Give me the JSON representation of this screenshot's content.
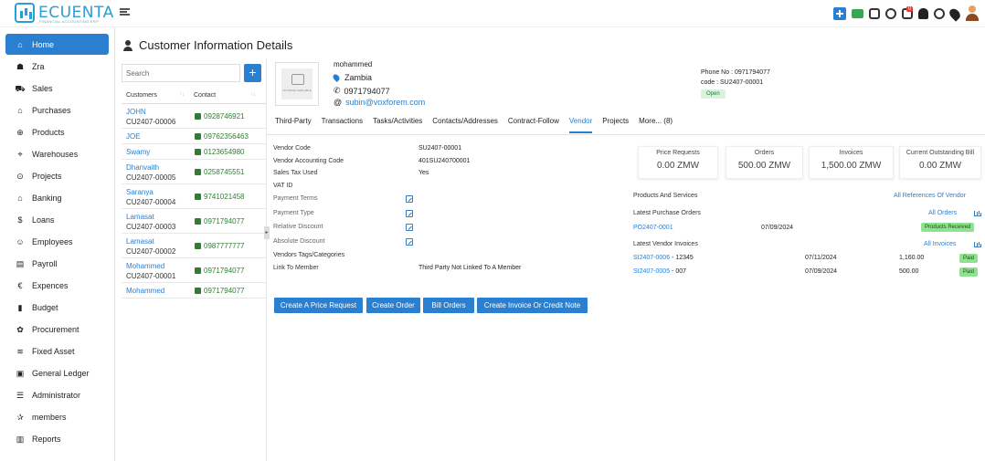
{
  "logo": {
    "text": "ECUENTA",
    "tagline": "FINANCIAL ACCOUNTING ERP"
  },
  "topbar": {
    "icons": [
      "plus-icon",
      "cash-icon",
      "printer-icon",
      "settings-icon",
      "building-icon",
      "bell-icon",
      "history-icon",
      "location-icon",
      "user-avatar-icon"
    ],
    "building_badge": "0"
  },
  "sidebar": {
    "items": [
      {
        "label": "Home",
        "icon": "⌂",
        "name": "home"
      },
      {
        "label": "Zra",
        "icon": "☗",
        "name": "zra"
      },
      {
        "label": "Sales",
        "icon": "⛟",
        "name": "sales"
      },
      {
        "label": "Purchases",
        "icon": "⌂",
        "name": "purchases"
      },
      {
        "label": "Products",
        "icon": "⊕",
        "name": "products"
      },
      {
        "label": "Warehouses",
        "icon": "⌖",
        "name": "warehouses"
      },
      {
        "label": "Projects",
        "icon": "⊙",
        "name": "projects"
      },
      {
        "label": "Banking",
        "icon": "⌂",
        "name": "banking"
      },
      {
        "label": "Loans",
        "icon": "$",
        "name": "loans"
      },
      {
        "label": "Employees",
        "icon": "☺",
        "name": "employees"
      },
      {
        "label": "Payroll",
        "icon": "▤",
        "name": "payroll"
      },
      {
        "label": "Expences",
        "icon": "€",
        "name": "expences"
      },
      {
        "label": "Budget",
        "icon": "▮",
        "name": "budget"
      },
      {
        "label": "Procurement",
        "icon": "✿",
        "name": "procurement"
      },
      {
        "label": "Fixed Asset",
        "icon": "≋",
        "name": "fixed-asset"
      },
      {
        "label": "General Ledger",
        "icon": "▣",
        "name": "general-ledger"
      },
      {
        "label": "Administrator",
        "icon": "☰",
        "name": "administrator"
      },
      {
        "label": "members",
        "icon": "✰",
        "name": "members"
      },
      {
        "label": "Reports",
        "icon": "▥",
        "name": "reports"
      }
    ]
  },
  "page": {
    "title": "Customer Information Details"
  },
  "customers": {
    "search_placeholder": "Search",
    "add_label": "+",
    "col_customers": "Customers",
    "col_contact": "Contact",
    "rows": [
      {
        "name": "JOHN",
        "code": "CU2407-00006",
        "phone": "0928746921"
      },
      {
        "name": "JOE",
        "code": "",
        "phone": "09762356463"
      },
      {
        "name": "Swamy",
        "code": "",
        "phone": "0123654980"
      },
      {
        "name": "Dhanvaith",
        "code": "CU2407-00005",
        "phone": "0258745551"
      },
      {
        "name": "Saranya",
        "code": "CU2407-00004",
        "phone": "9741021458"
      },
      {
        "name": "Lamasat",
        "code": "CU2407-00003",
        "phone": "0971794077"
      },
      {
        "name": "Lamasat",
        "code": "CU2407-00002",
        "phone": "0987777777"
      },
      {
        "name": "Mohammed",
        "code": "CU2407-00001",
        "phone": "0971794077"
      },
      {
        "name": "Mohammed",
        "code": "",
        "phone": "0971794077"
      }
    ]
  },
  "profile": {
    "photo_text": "NO IMAGE AVAILABLE",
    "name": "mohammed",
    "country": "Zambia",
    "phone": "0971794077",
    "email": "subin@voxforem.com",
    "phone_no": "Phone No : 0971794077",
    "code": "code : SU2407-00001",
    "status": "Open"
  },
  "tabs": [
    "Third-Party",
    "Transactions",
    "Tasks/Activities",
    "Contacts/Addresses",
    "Contract-Follow",
    "Vendor",
    "Projects",
    "More... (8)"
  ],
  "active_tab": "Vendor",
  "vendor": {
    "fields": [
      {
        "label": "Vendor Code",
        "value": "SU2407-00001",
        "muted": false,
        "editable": false
      },
      {
        "label": "Vendor Accounting Code",
        "value": "401SU240700001",
        "muted": false,
        "editable": false
      },
      {
        "label": "Sales Tax Used",
        "value": "Yes",
        "muted": false,
        "editable": false
      },
      {
        "label": "VAT ID",
        "value": "",
        "muted": false,
        "editable": false
      },
      {
        "label": "Payment Terms",
        "value": "",
        "muted": true,
        "editable": true
      },
      {
        "label": "Payment Type",
        "value": "",
        "muted": true,
        "editable": true
      },
      {
        "label": "Relative Discount",
        "value": "",
        "muted": true,
        "editable": true
      },
      {
        "label": "Absolute Discount",
        "value": "",
        "muted": true,
        "editable": true
      },
      {
        "label": "Vendors Tags/Categories",
        "value": "",
        "muted": false,
        "editable": false
      },
      {
        "label": "Link To Member",
        "value": "Third Party Not Linked To A Member",
        "muted": false,
        "editable": false
      }
    ]
  },
  "stats": [
    {
      "label": "Price Requests",
      "value": "0.00 ZMW"
    },
    {
      "label": "Orders",
      "value": "500.00 ZMW"
    },
    {
      "label": "Invoices",
      "value": "1,500.00 ZMW"
    },
    {
      "label": "Current Outstanding Bill",
      "value": "0.00 ZMW"
    }
  ],
  "products_services": {
    "title": "Products And Services",
    "link": "All References Of Vendor"
  },
  "purchase_orders": {
    "title": "Latest Purchase Orders",
    "link": "All Orders",
    "rows": [
      {
        "ref": "PO2407-0001",
        "date": "07/09/2024",
        "status": "Products Received"
      }
    ]
  },
  "vendor_invoices": {
    "title": "Latest Vendor Invoices",
    "link": "All Invoices",
    "rows": [
      {
        "ref": "SI2407-0006",
        "suffix": " - 12345",
        "date": "07/11/2024",
        "amount": "1,160.00",
        "status": "Paid"
      },
      {
        "ref": "SI2407-0005",
        "suffix": " - 007",
        "date": "07/09/2024",
        "amount": "500.00",
        "status": "Paid"
      }
    ]
  },
  "actions": [
    "Create A Price Request",
    "Create Order",
    "Bill Orders",
    "Create Invoice Or Credit Note"
  ]
}
